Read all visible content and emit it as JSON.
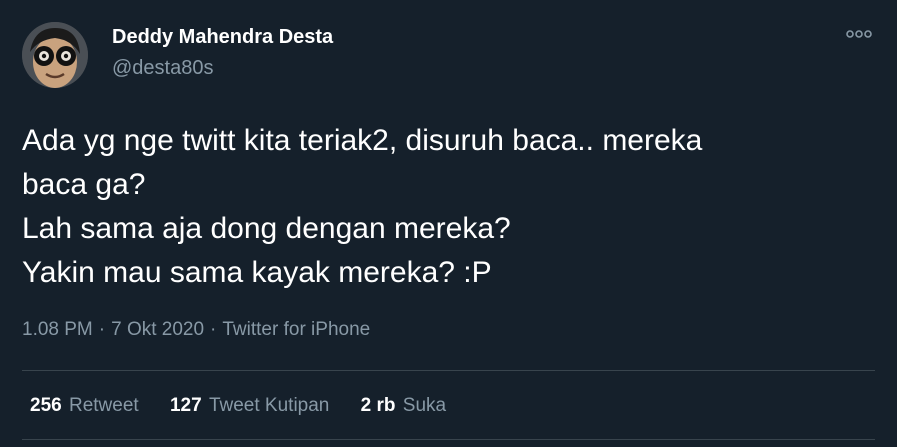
{
  "author": {
    "display_name": "Deddy Mahendra Desta",
    "handle": "@desta80s",
    "avatar_icon": "profile-photo-avatar"
  },
  "menu": {
    "icon": "more-options-icon"
  },
  "tweet": {
    "lines": [
      "Ada yg nge twitt kita teriak2, disuruh baca.. mereka",
      "baca ga?",
      "Lah sama aja dong dengan mereka?",
      "Yakin mau sama kayak mereka? :P"
    ]
  },
  "meta": {
    "time": "1.08 PM",
    "separator": "·",
    "date": "7 Okt 2020",
    "source": "Twitter for iPhone"
  },
  "stats": {
    "retweets": {
      "count": "256",
      "label": "Retweet"
    },
    "quotes": {
      "count": "127",
      "label": "Tweet Kutipan"
    },
    "likes": {
      "count": "2 rb",
      "label": "Suka"
    }
  },
  "colors": {
    "background": "#15202b",
    "primary_text": "#ffffff",
    "secondary_text": "#8899a6",
    "divider": "#38444d"
  }
}
